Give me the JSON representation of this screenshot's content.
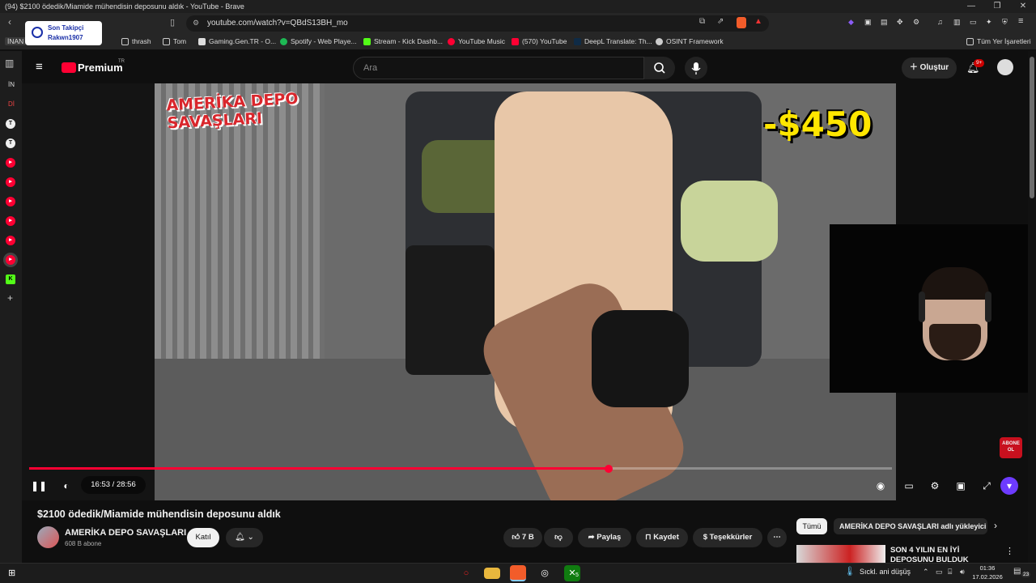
{
  "window": {
    "title": "(94) $2100 ödedik/Miamide mühendisin deposunu aldık - YouTube - Brave"
  },
  "browser": {
    "url": "youtube.com/watch?v=QBdS13BH_mo",
    "bookmarks": [
      {
        "label": "İNAN"
      },
      {
        "label": "thrash"
      },
      {
        "label": "Tom"
      },
      {
        "label": "Gaming.Gen.TR - O..."
      },
      {
        "label": "Spotify - Web Playe..."
      },
      {
        "label": "Stream - Kick Dashb..."
      },
      {
        "label": "YouTube Music"
      },
      {
        "label": "(570) YouTube"
      },
      {
        "label": "DeepL Translate: Th..."
      },
      {
        "label": "OSINT Framework"
      }
    ],
    "all_bookmarks": "Tüm Yer İşaretleri"
  },
  "overlay_notification": {
    "line1": "Son Takipçi",
    "line2": "Rakwn1907"
  },
  "sidebar": {
    "items": [
      "İN",
      "Dİ"
    ]
  },
  "youtube": {
    "logo_text": "Premium",
    "logo_region": "TR",
    "search_placeholder": "Ara",
    "create_label": "Oluştur",
    "notification_count": "9+"
  },
  "video": {
    "overlay_title": "AMERİKA DEPO SAVAŞLARI",
    "overlay_price": "-$450",
    "time": "16:53 / 28:56",
    "progress": 0.6719,
    "title": "$2100 ödedik/Miamide mühendisin deposunu aldık",
    "abone_badge": "ABONE OL"
  },
  "channel": {
    "name": "AMERİKA DEPO SAVAŞLARI",
    "subscribers": "608 B abone",
    "join_label": "Katıl"
  },
  "actions": {
    "likes": "7 B",
    "share": "Paylaş",
    "save": "Kaydet",
    "thanks": "Teşekkürler"
  },
  "recommendations": {
    "chip_all": "Tümü",
    "chip_channel": "AMERİKA DEPO SAVAŞLARI adlı yükleyici",
    "first_title": "SON 4 YILIN EN İYİ DEPOSUNU BULDUK"
  },
  "taskbar": {
    "weather": "Sıckl. ani düşüş",
    "time": "01:36",
    "date": "17.02.2026",
    "xbox_badge": "5",
    "notif_count": "23"
  }
}
